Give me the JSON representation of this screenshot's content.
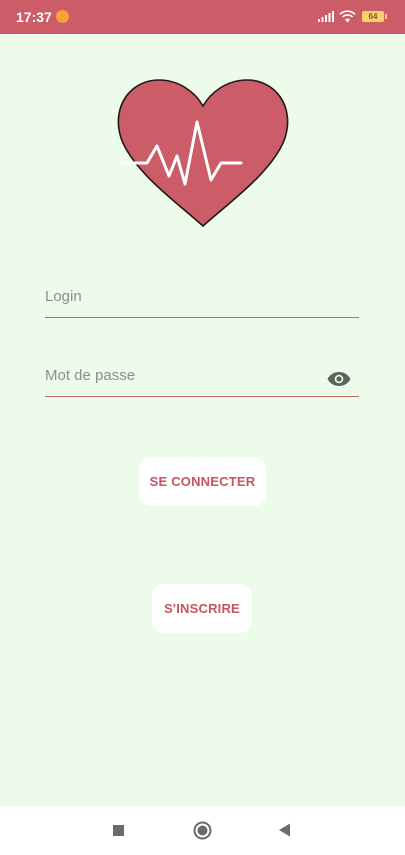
{
  "status_bar": {
    "time": "17:37",
    "battery": "64",
    "icons": [
      "notification-icon",
      "signal-icon",
      "wifi-icon",
      "battery-icon"
    ],
    "background": "#cc5c68"
  },
  "logo": {
    "icon": "heart-pulse-icon",
    "color": "#cc5c68"
  },
  "form": {
    "login_placeholder": "Login",
    "password_placeholder": "Mot de passe",
    "password_toggle_icon": "eye-icon",
    "underline_color": "#c46a6c"
  },
  "buttons": {
    "login_label": "SE CONNECTER",
    "register_label": "S'INSCRIRE",
    "text_color": "#c7545f"
  },
  "nav_bar": {
    "icons": [
      "recent-apps-icon",
      "home-icon",
      "back-icon"
    ]
  },
  "theme": {
    "background": "#ecfbea"
  }
}
